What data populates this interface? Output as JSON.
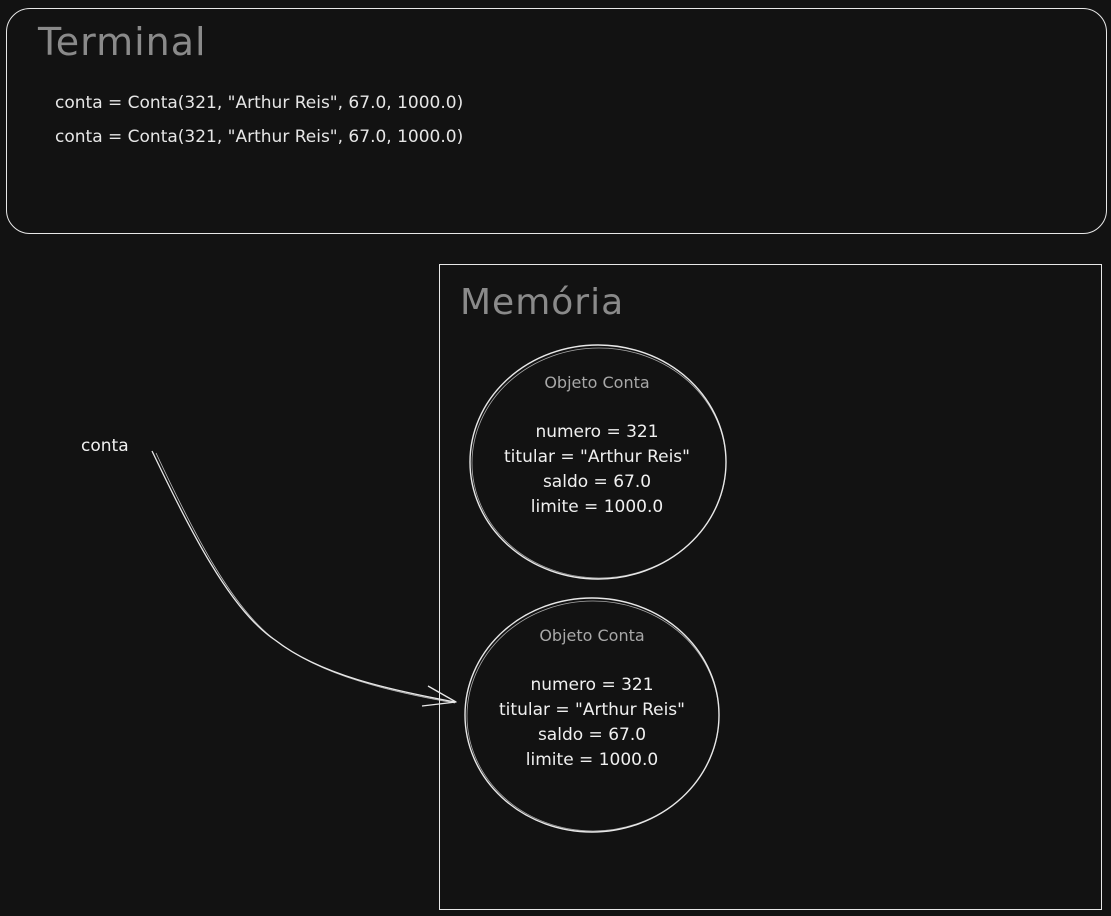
{
  "terminal": {
    "title": "Terminal",
    "lines": [
      "conta = Conta(321, \"Arthur Reis\", 67.0, 1000.0)",
      "conta = Conta(321, \"Arthur Reis\", 67.0, 1000.0)"
    ]
  },
  "memory": {
    "title": "Memória",
    "objects": [
      {
        "title": "Objeto Conta",
        "fields": [
          "numero = 321",
          "titular = \"Arthur Reis\"",
          "saldo = 67.0",
          "limite = 1000.0"
        ]
      },
      {
        "title": "Objeto Conta",
        "fields": [
          "numero = 321",
          "titular = \"Arthur Reis\"",
          "saldo = 67.0",
          "limite = 1000.0"
        ]
      }
    ]
  },
  "variable": {
    "label": "conta"
  },
  "colors": {
    "background": "#121212",
    "stroke": "#e8e8e8",
    "title_text": "#8a8a8a",
    "body_text": "#f0f0f0"
  }
}
